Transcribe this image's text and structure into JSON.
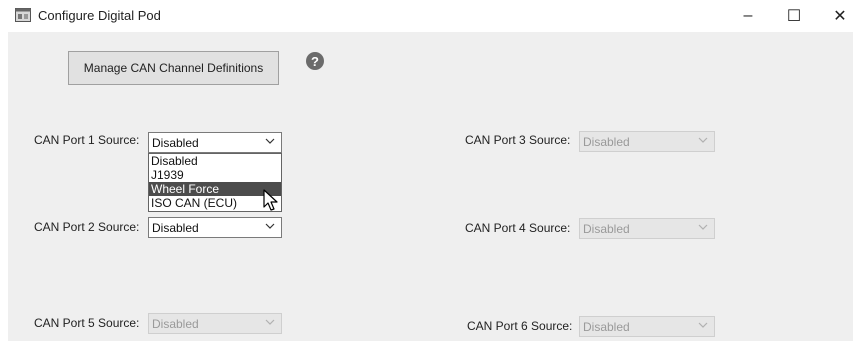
{
  "window": {
    "title": "Configure Digital Pod",
    "minimize": "–",
    "maximize": "☐",
    "close": "✕"
  },
  "toolbar": {
    "manage_label": "Manage CAN Channel Definitions",
    "help_label": "?"
  },
  "ports": [
    {
      "label": "CAN Port 1 Source:",
      "value": "Disabled",
      "enabled": true
    },
    {
      "label": "CAN Port 2 Source:",
      "value": "Disabled",
      "enabled": true
    },
    {
      "label": "CAN Port 3 Source:",
      "value": "Disabled",
      "enabled": false
    },
    {
      "label": "CAN Port 4 Source:",
      "value": "Disabled",
      "enabled": false
    },
    {
      "label": "CAN Port 5 Source:",
      "value": "Disabled",
      "enabled": false
    },
    {
      "label": "CAN Port 6 Source:",
      "value": "Disabled",
      "enabled": false
    }
  ],
  "dropdown": {
    "options": [
      "Disabled",
      "J1939",
      "Wheel Force",
      "ISO CAN (ECU)"
    ],
    "highlighted": "Wheel Force"
  },
  "icons": {
    "app": "app-window-icon",
    "help": "question-circle-icon",
    "chevron": "chevron-down-icon",
    "cursor": "mouse-pointer-icon"
  }
}
